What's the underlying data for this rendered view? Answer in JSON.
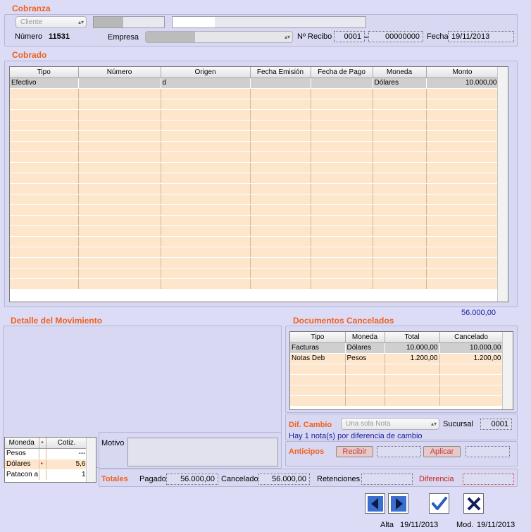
{
  "cobranza": {
    "title": "Cobranza",
    "cliente_placeholder": "Cliente",
    "numero_label": "Número",
    "numero_value": "11531",
    "empresa_label": "Empresa",
    "recibo_label": "Nº Recibo",
    "recibo_serie": "0001",
    "recibo_numero": "00000000",
    "fecha_label": "Fecha",
    "fecha_value": "19/11/2013"
  },
  "cobrado": {
    "title": "Cobrado",
    "columns": [
      "Tipo",
      "Número",
      "Origen",
      "Fecha Emisión",
      "Fecha de Pago",
      "Moneda",
      "Monto"
    ],
    "rows": [
      [
        "Efectivo",
        "",
        "d",
        "",
        "",
        "Dólares",
        "10.000,00"
      ]
    ],
    "total": "56.000,00"
  },
  "detalle": {
    "title": "Detalle del Movimiento"
  },
  "documentos": {
    "title": "Documentos Cancelados",
    "columns": [
      "Tipo",
      "Moneda",
      "Total",
      "Cancelado"
    ],
    "rows": [
      [
        "Facturas",
        "Dólares",
        "10.000,00",
        "10.000,00"
      ],
      [
        "Notas Deb",
        "Pesos",
        "1.200,00",
        "1.200,00"
      ]
    ]
  },
  "cotiz": {
    "columns": [
      "Moneda",
      "•",
      "Cotiz."
    ],
    "rows": [
      [
        "Pesos",
        "",
        "---"
      ],
      [
        "Dólares",
        "•",
        "5,6"
      ],
      [
        "Patacon a",
        "",
        "1"
      ]
    ]
  },
  "motivo": {
    "label": "Motivo"
  },
  "dif_cambio": {
    "label": "Dif. Cambio",
    "select_value": "Una sola Nota",
    "sucursal_label": "Sucursal",
    "sucursal_value": "0001",
    "note": "Hay 1 nota(s) por diferencia de cambio"
  },
  "anticipos": {
    "label": "Anticipos",
    "recibir_label": "Recibir",
    "aplicar_label": "Aplicar"
  },
  "totales": {
    "label": "Totales",
    "pagado_label": "Pagado",
    "pagado_value": "56.000,00",
    "cancelado_label": "Cancelado",
    "cancelado_value": "56.000,00",
    "retenciones_label": "Retenciones",
    "diferencia_label": "Diferencia"
  },
  "footer": {
    "alta_label": "Alta",
    "alta_value": "19/11/2013",
    "mod_label": "Mod.",
    "mod_value": "19/11/2013"
  },
  "colors": {
    "accent": "#f0601c",
    "link": "#1a1aa0",
    "row_fill": "#fde6cc",
    "selected": "#cfcfcf"
  }
}
